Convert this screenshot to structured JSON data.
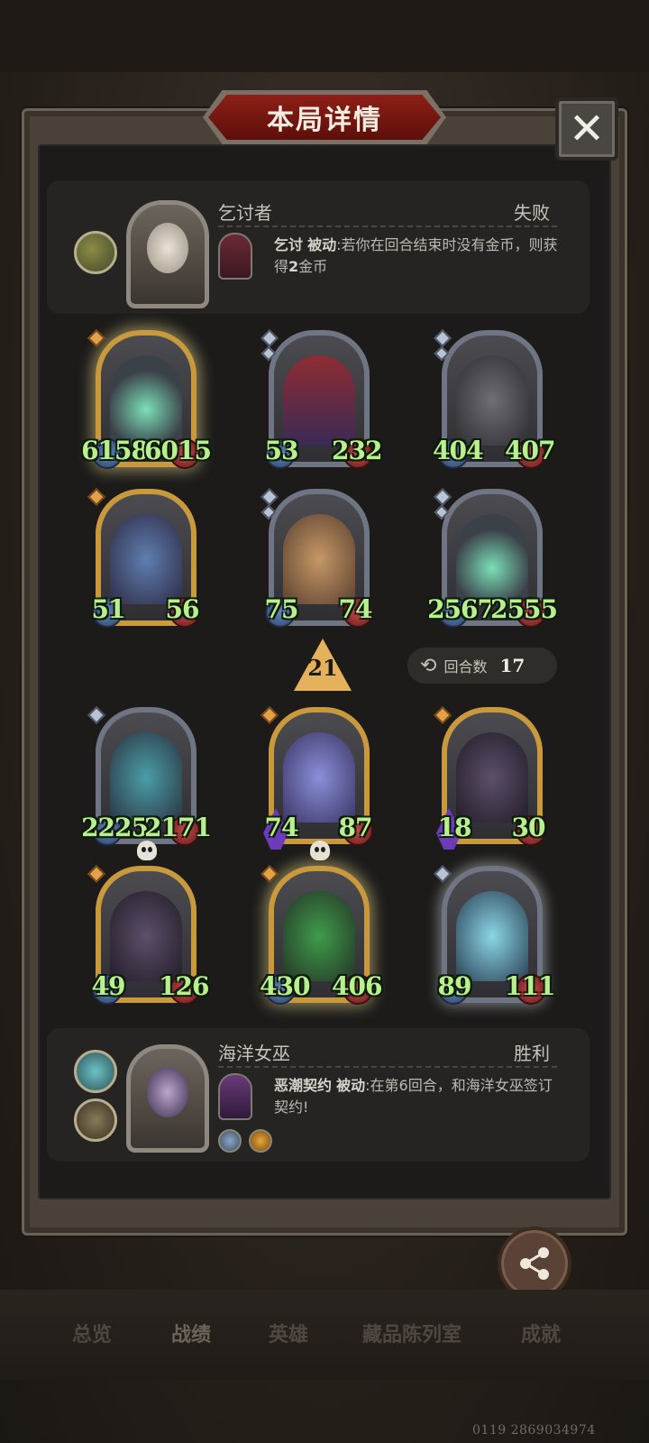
{
  "header": {
    "title": "本局详情",
    "close_label": "✕"
  },
  "top_player": {
    "name": "乞讨者",
    "result": "失败",
    "ability_name": "乞讨",
    "ability_tag": "被动",
    "ability_text": ":若你在回合结束时没有金币，则获得",
    "ability_amount": "2",
    "ability_tail": "金币"
  },
  "round_info": {
    "tier": "21",
    "round_label": "回合数",
    "round_value": "17"
  },
  "top_board": [
    {
      "atk": "6158",
      "hp": "6015"
    },
    {
      "atk": "53",
      "hp": "232"
    },
    {
      "atk": "404",
      "hp": "407"
    },
    {
      "atk": "51",
      "hp": "56"
    },
    {
      "atk": "75",
      "hp": "74"
    },
    {
      "atk": "2567",
      "hp": "2555"
    }
  ],
  "bottom_board": [
    {
      "atk": "2225",
      "hp": "2171"
    },
    {
      "atk": "74",
      "hp": "87"
    },
    {
      "atk": "18",
      "hp": "30"
    },
    {
      "atk": "49",
      "hp": "126"
    },
    {
      "atk": "430",
      "hp": "406"
    },
    {
      "atk": "89",
      "hp": "111"
    }
  ],
  "bottom_player": {
    "name": "海洋女巫",
    "result": "胜利",
    "ability_name": "恶潮契约",
    "ability_tag": "被动",
    "ability_text": ":在第6回合，和海洋女巫签订契约!"
  },
  "share": {
    "label": "分享"
  },
  "nav": {
    "items": [
      "总览",
      "战绩",
      "英雄",
      "藏品陈列室",
      "成就"
    ],
    "active": "战绩"
  },
  "footer": {
    "id": "0119 2869034974"
  },
  "colors": {
    "stat_green": "#b8f08d",
    "title_red": "#8d1f17",
    "frame_gold": "#c99a3d",
    "tier_gold": "#e4b15c"
  }
}
